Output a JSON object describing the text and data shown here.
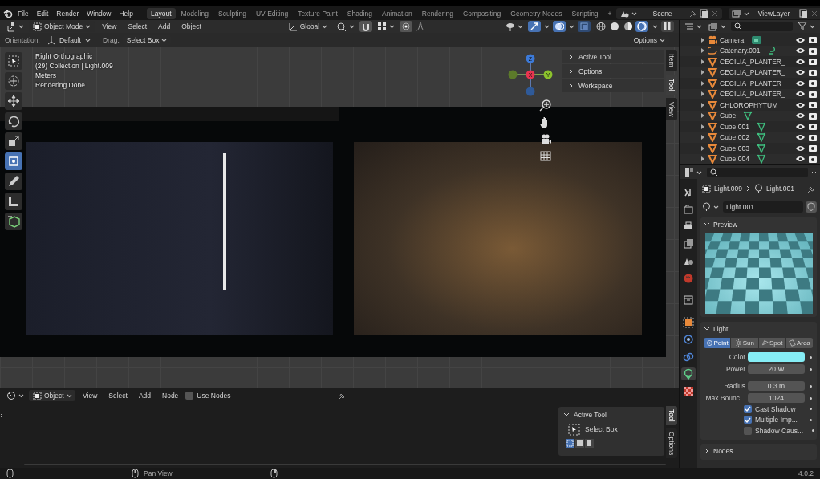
{
  "menubar": {
    "menus": [
      "File",
      "Edit",
      "Render",
      "Window",
      "Help"
    ],
    "workspaces": [
      {
        "label": "Layout",
        "selected": true
      },
      {
        "label": "Modeling",
        "selected": false
      },
      {
        "label": "Sculpting",
        "selected": false
      },
      {
        "label": "UV Editing",
        "selected": false
      },
      {
        "label": "Texture Paint",
        "selected": false
      },
      {
        "label": "Shading",
        "selected": false
      },
      {
        "label": "Animation",
        "selected": false
      },
      {
        "label": "Rendering",
        "selected": false
      },
      {
        "label": "Compositing",
        "selected": false
      },
      {
        "label": "Geometry Nodes",
        "selected": false
      },
      {
        "label": "Scripting",
        "selected": false
      }
    ],
    "add_tab": "+",
    "scene": "Scene",
    "view_layer": "ViewLayer"
  },
  "viewport": {
    "mode": "Object Mode",
    "menus": [
      "View",
      "Select",
      "Add",
      "Object"
    ],
    "orientation": "Global",
    "toggles": {
      "snap": true,
      "gizmos": true,
      "overlays": true,
      "xray": true
    },
    "shading": [
      {
        "kind": "wireframe",
        "selected": false
      },
      {
        "kind": "solid",
        "selected": false
      },
      {
        "kind": "material",
        "selected": false
      },
      {
        "kind": "rendered",
        "selected": true
      }
    ],
    "tool_settings": {
      "orientation_label": "Orientation:",
      "orientation": "Default",
      "drag_label": "Drag:",
      "drag": "Select Box",
      "options": "Options"
    },
    "info": [
      "Right Orthographic",
      "(29) Collection | Light.009",
      "Meters",
      "Rendering Done"
    ],
    "tools": [
      {
        "kind": "select",
        "selected": false
      },
      {
        "kind": "cursor",
        "selected": false
      },
      {
        "kind": "move",
        "selected": false
      },
      {
        "kind": "rotate",
        "selected": false
      },
      {
        "kind": "scale",
        "selected": false
      },
      {
        "kind": "transform",
        "selected": true
      },
      {
        "kind": "annotate",
        "selected": false
      },
      {
        "kind": "measure",
        "selected": false
      },
      {
        "kind": "add_cube",
        "selected": false
      }
    ],
    "axes": {
      "x": "X",
      "y": "Y",
      "z": "Z"
    },
    "sidebar": {
      "panels": [
        {
          "label": "Active Tool",
          "expanded": false
        },
        {
          "label": "Options",
          "expanded": false
        },
        {
          "label": "Workspace",
          "expanded": false
        }
      ],
      "tabs": [
        {
          "label": "Item",
          "selected": false
        },
        {
          "label": "Tool",
          "selected": true
        },
        {
          "label": "View",
          "selected": false
        }
      ]
    }
  },
  "shader_editor": {
    "object": "Object",
    "menus": [
      "View",
      "Select",
      "Add",
      "Node"
    ],
    "use_nodes": {
      "label": "Use Nodes",
      "checked": false
    },
    "sidebar": {
      "panel": {
        "label": "Active Tool",
        "expanded": true
      },
      "tool": "Select Box",
      "tabs": [
        {
          "label": "Tool",
          "selected": true
        },
        {
          "label": "Options",
          "selected": false
        }
      ]
    }
  },
  "outliner": {
    "rows": [
      {
        "name": "Camera",
        "kind": "camera",
        "data": {
          "kind": "camera"
        }
      },
      {
        "name": "Catenary.001",
        "kind": "curve",
        "data": {
          "kind": "curve"
        }
      },
      {
        "name": "CECILIA_PLANTER_",
        "kind": "mesh"
      },
      {
        "name": "CECILIA_PLANTER_",
        "kind": "mesh"
      },
      {
        "name": "CECILIA_PLANTER_",
        "kind": "mesh"
      },
      {
        "name": "CECILIA_PLANTER_",
        "kind": "mesh"
      },
      {
        "name": "CHLOROPHYTUM",
        "kind": "mesh"
      },
      {
        "name": "Cube",
        "kind": "mesh",
        "data": {
          "kind": "mesh"
        }
      },
      {
        "name": "Cube.001",
        "kind": "mesh",
        "data": {
          "kind": "mesh"
        }
      },
      {
        "name": "Cube.002",
        "kind": "mesh",
        "data": {
          "kind": "mesh"
        }
      },
      {
        "name": "Cube.003",
        "kind": "mesh",
        "data": {
          "kind": "mesh"
        }
      },
      {
        "name": "Cube.004",
        "kind": "mesh",
        "data": {
          "kind": "mesh"
        }
      }
    ]
  },
  "properties": {
    "tabs": [
      {
        "kind": "tool",
        "selected": false
      },
      {
        "kind": "render",
        "selected": false
      },
      {
        "kind": "output",
        "selected": false
      },
      {
        "kind": "view_layer",
        "selected": false
      },
      {
        "kind": "scene",
        "selected": false
      },
      {
        "kind": "world",
        "selected": false
      },
      {
        "kind": "collection",
        "selected": false
      },
      {
        "kind": "object",
        "selected": false
      },
      {
        "kind": "physics",
        "selected": false
      },
      {
        "kind": "constraints",
        "selected": false
      },
      {
        "kind": "light",
        "selected": true
      },
      {
        "kind": "texture",
        "selected": false
      }
    ],
    "breadcrumb": [
      "Light.009",
      "Light.001"
    ],
    "datablock": "Light.001",
    "preview": {
      "title": "Preview",
      "expanded": true
    },
    "light": {
      "title": "Light",
      "expanded": true,
      "types": [
        {
          "label": "Point",
          "selected": true
        },
        {
          "label": "Sun",
          "selected": false
        },
        {
          "label": "Spot",
          "selected": false
        },
        {
          "label": "Area",
          "selected": false
        }
      ],
      "field_groups": [
        [
          {
            "label": "Color",
            "kind": "color",
            "color": "#86eef6"
          },
          {
            "label": "Power",
            "kind": "number",
            "value": "20 W"
          }
        ],
        [
          {
            "label": "Radius",
            "kind": "number",
            "value": "0.3 m"
          },
          {
            "label": "Max Bounc...",
            "kind": "number",
            "value": "1024"
          }
        ]
      ],
      "options": [
        {
          "label": "Cast Shadow",
          "checked": true
        },
        {
          "label": "Multiple Imp...",
          "checked": true
        },
        {
          "label": "Shadow Caus...",
          "checked": false
        }
      ]
    },
    "nodes": {
      "title": "Nodes",
      "expanded": false
    }
  },
  "status_bar": {
    "hint": "Pan View",
    "version": "4.0.2"
  }
}
